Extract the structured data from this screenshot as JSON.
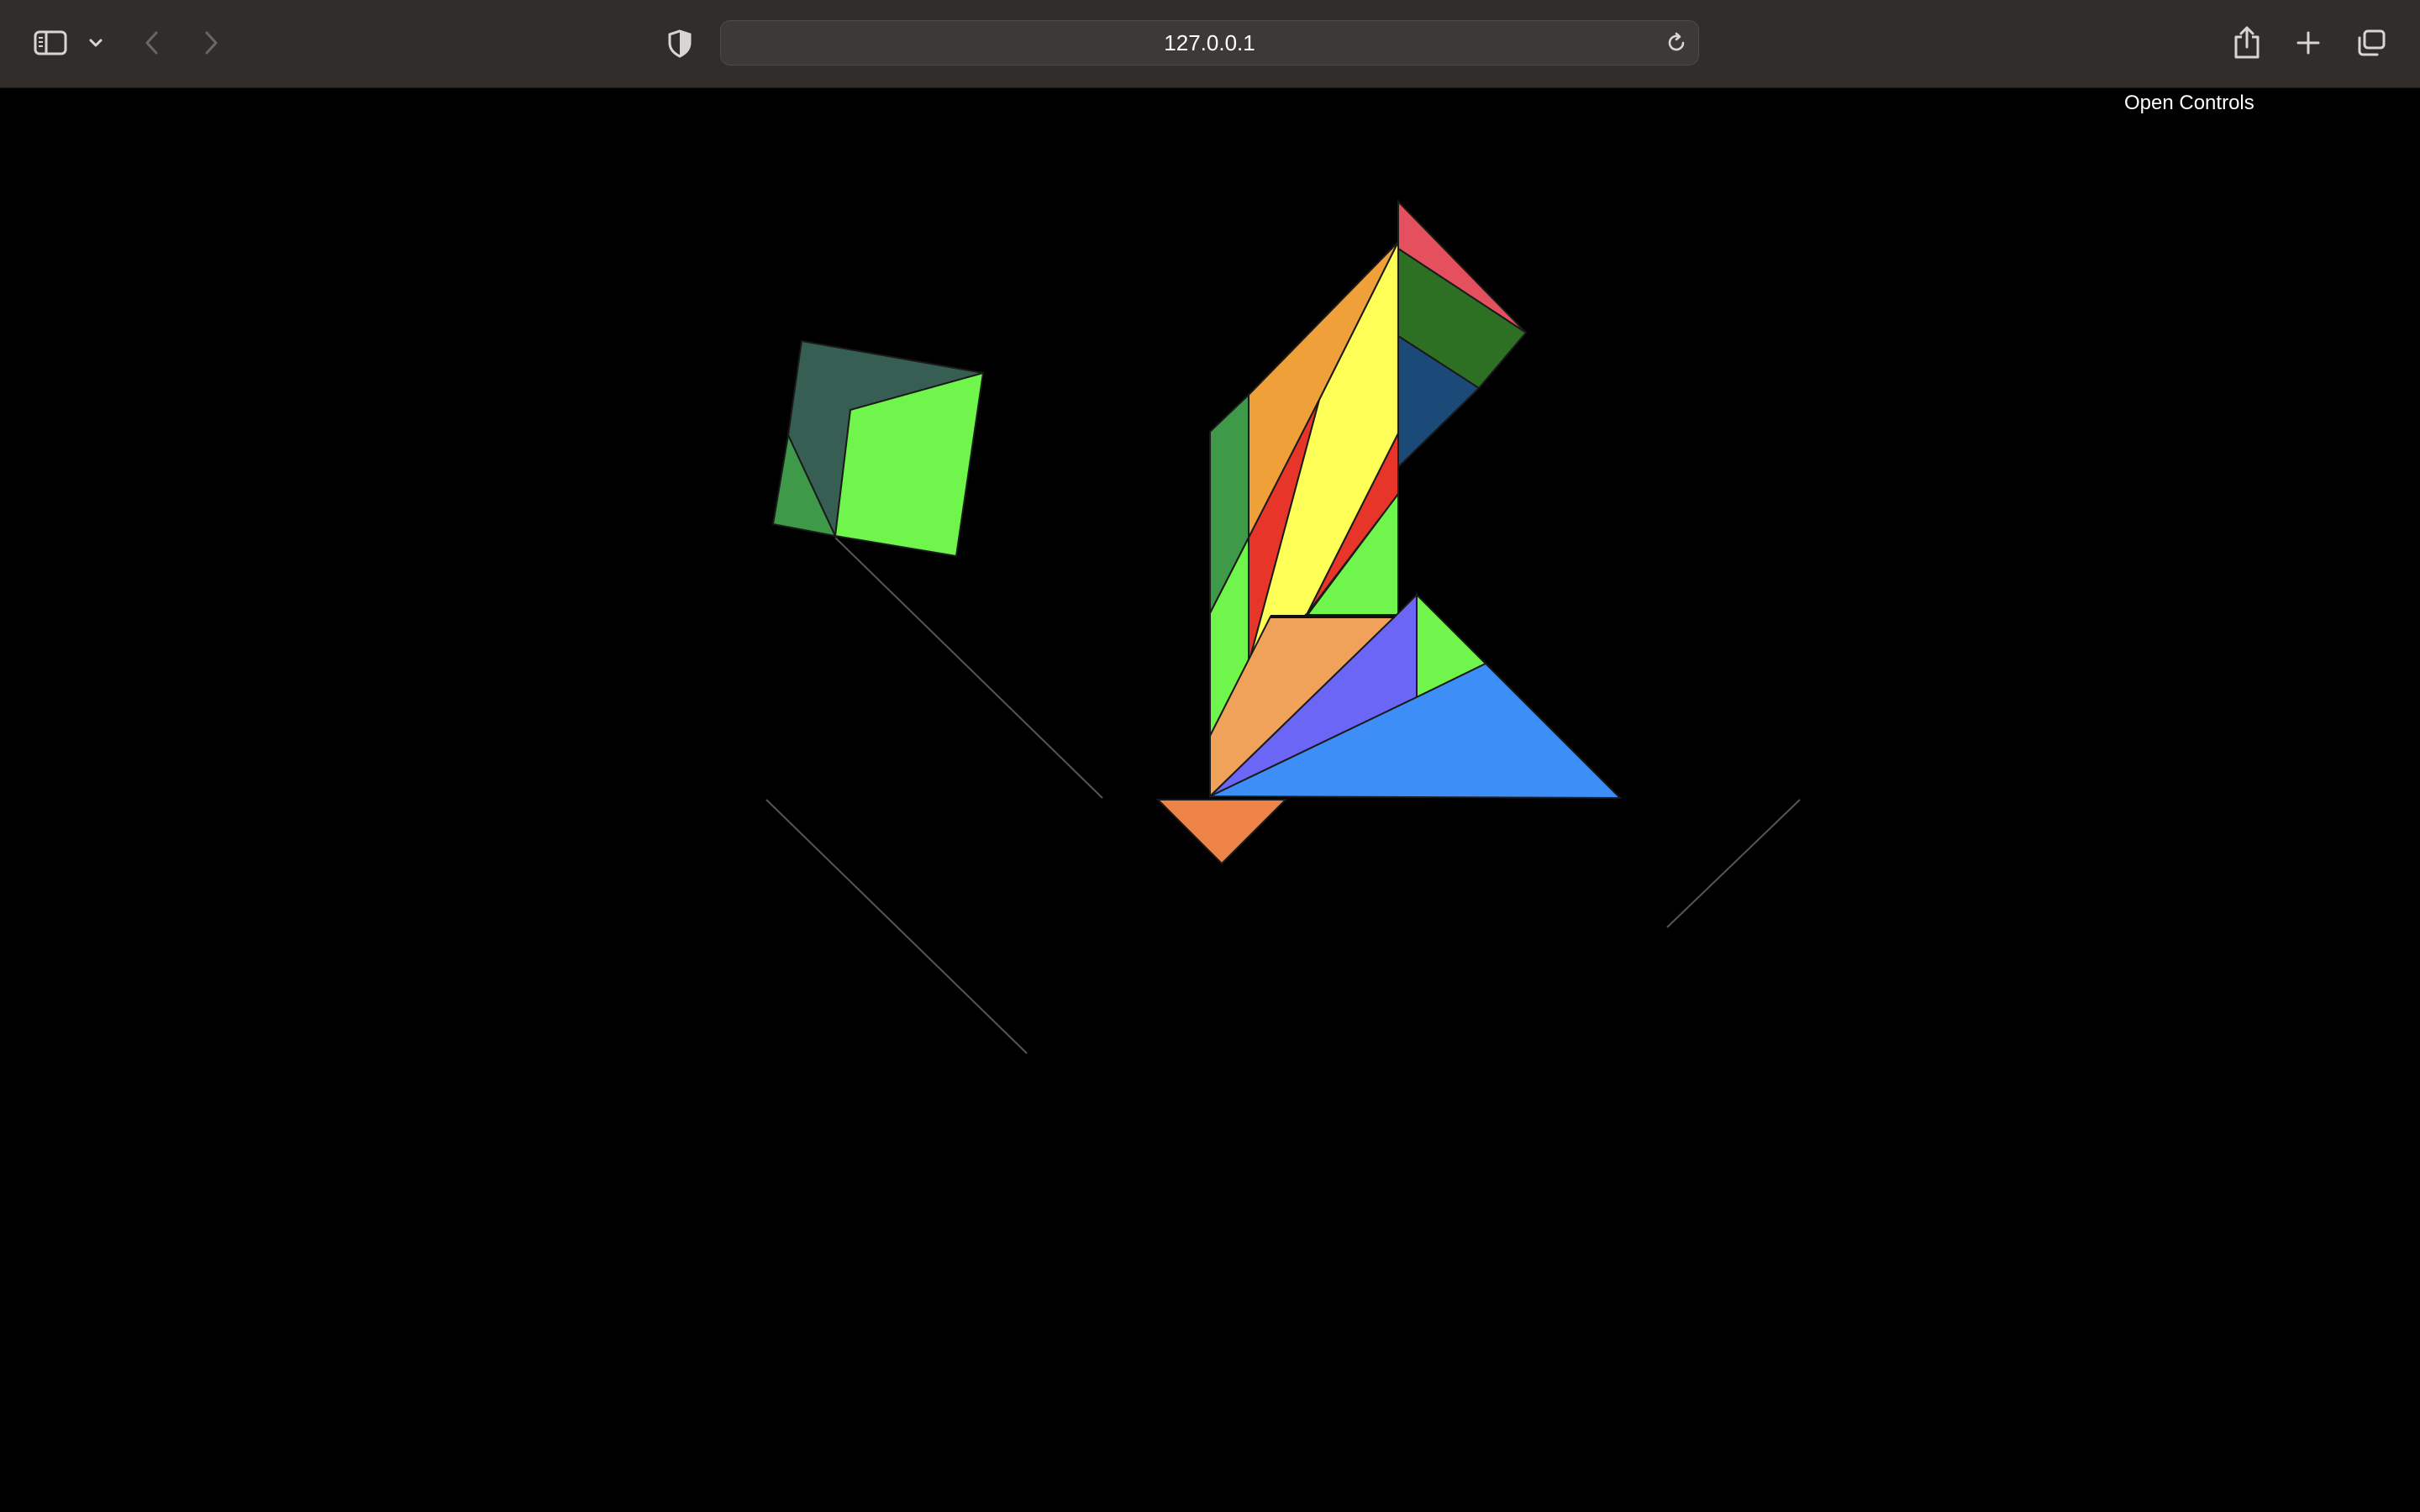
{
  "browser": {
    "address": "127.0.0.1",
    "icons": {
      "sidebar": "sidebar-icon",
      "sidebar_menu": "chevron-down-icon",
      "back": "chevron-left-icon",
      "forward": "chevron-right-icon",
      "privacy": "shield-icon",
      "reload": "reload-icon",
      "share": "share-icon",
      "new_tab": "plus-icon",
      "tabs": "tabs-overview-icon"
    }
  },
  "page": {
    "open_controls_label": "Open Controls"
  },
  "colors": {
    "toolbar_bg": "#312d2b",
    "content_bg": "#000000",
    "pink": "#e5505f",
    "dark_green": "#2e7023",
    "navy": "#1c4a78",
    "orange": "#f0a038",
    "yellow": "#feff57",
    "red": "#e8352a",
    "mid_green": "#3e9a48",
    "lime": "#6ff54b",
    "peach": "#f0a25b",
    "violet": "#6b66f5",
    "sky_blue": "#3d8ff7",
    "coral": "#ef8449",
    "slate_green": "#365e52"
  }
}
